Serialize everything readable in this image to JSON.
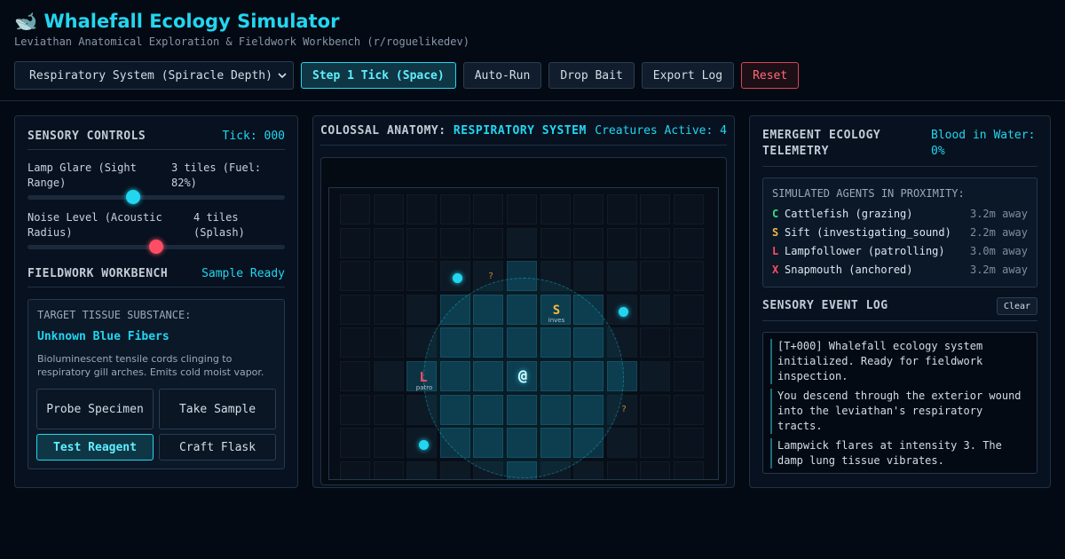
{
  "header": {
    "title": "🐋 Whalefall Ecology Simulator",
    "subtitle": "Leviathan Anatomical Exploration & Fieldwork Workbench (r/roguelikedev)"
  },
  "toolbar": {
    "system_select": "Respiratory System (Spiracle Depth)",
    "step_label": "Step 1 Tick (Space)",
    "autorun_label": "Auto-Run",
    "bait_label": "Drop Bait",
    "export_label": "Export Log",
    "reset_label": "Reset"
  },
  "sensory": {
    "title": "SENSORY CONTROLS",
    "tick": "Tick: 000",
    "lamp_label": "Lamp Glare (Sight Range)",
    "lamp_value": "3 tiles (Fuel: 82%)",
    "lamp_level": 0.41,
    "noise_label": "Noise Level (Acoustic Radius)",
    "noise_value": "4 tiles (Splash)",
    "noise_level": 0.5
  },
  "workbench": {
    "title": "FIELDWORK WORKBENCH",
    "status": "Sample Ready",
    "target_label": "TARGET TISSUE SUBSTANCE:",
    "substance_name": "Unknown Blue Fibers",
    "description": "Bioluminescent tensile cords clinging to respiratory gill arches. Emits cold moist vapor.",
    "buttons": {
      "probe": "Probe Specimen",
      "sample": "Take Sample",
      "reagent": "Test Reagent",
      "flask": "Craft Flask"
    }
  },
  "anatomy": {
    "title_prefix": "COLOSSAL ANATOMY:",
    "system_name": "RESPIRATORY SYSTEM",
    "creatures_active": "Creatures Active: 4",
    "map": {
      "player_glyph": "@",
      "sift_glyph": "S",
      "sift_tag": "inves",
      "lampfollower_glyph": "L",
      "lampfollower_tag": "patro",
      "unknown_glyph": "?"
    }
  },
  "telemetry": {
    "title": "EMERGENT ECOLOGY TELEMETRY",
    "blood": "Blood in Water: 0%",
    "agents_title": "SIMULATED AGENTS IN PROXIMITY:",
    "agents": [
      {
        "glyph": "C",
        "name": "Cattlefish (grazing)",
        "distance": "3.2m away",
        "color": "#3ddc84"
      },
      {
        "glyph": "S",
        "name": "Sift (investigating_sound)",
        "distance": "2.2m away",
        "color": "#f5b83d"
      },
      {
        "glyph": "L",
        "name": "Lampfollower (patrolling)",
        "distance": "3.0m away",
        "color": "#ff4d63"
      },
      {
        "glyph": "X",
        "name": "Snapmouth (anchored)",
        "distance": "3.2m away",
        "color": "#ff4d63"
      }
    ]
  },
  "event_log": {
    "title": "SENSORY EVENT LOG",
    "clear_label": "Clear",
    "entries": [
      "[T+000] Whalefall ecology system initialized. Ready for fieldwork inspection.",
      "You descend through the exterior wound into the leviathan's respiratory tracts.",
      "Lampwick flares at intensity 3. The damp lung tissue vibrates."
    ]
  },
  "colors": {
    "accent": "#22d6f0",
    "danger": "#ff4d63",
    "warning": "#f5b83d",
    "success": "#3ddc84"
  }
}
